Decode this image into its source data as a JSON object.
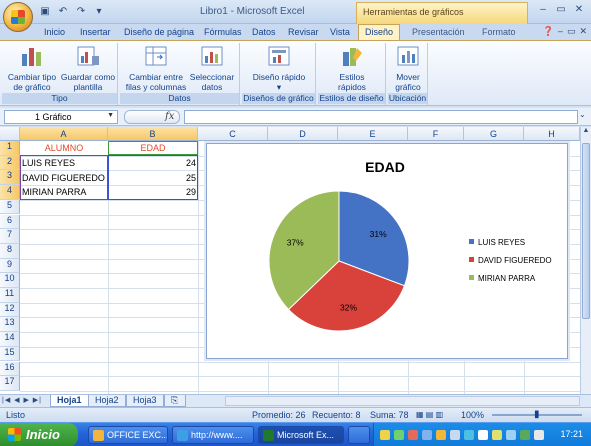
{
  "window": {
    "title": "Libro1 - Microsoft Excel",
    "contextual_header": "Herramientas de gráficos"
  },
  "tabs": [
    {
      "label": "Inicio"
    },
    {
      "label": "Insertar"
    },
    {
      "label": "Diseño de página"
    },
    {
      "label": "Fórmulas"
    },
    {
      "label": "Datos"
    },
    {
      "label": "Revisar"
    },
    {
      "label": "Vista"
    },
    {
      "label": "Diseño"
    },
    {
      "label": "Presentación"
    },
    {
      "label": "Formato"
    }
  ],
  "ribbon": {
    "groups": [
      {
        "label": "Tipo",
        "buttons": [
          {
            "label": "Cambiar tipo de gráfico"
          },
          {
            "label": "Guardar como plantilla"
          }
        ]
      },
      {
        "label": "Datos",
        "buttons": [
          {
            "label": "Cambiar entre filas y columnas"
          },
          {
            "label": "Seleccionar datos"
          }
        ]
      },
      {
        "label": "Diseños de gráfico",
        "buttons": [
          {
            "label": "Diseño rápido"
          }
        ]
      },
      {
        "label": "Estilos de diseño",
        "buttons": [
          {
            "label": "Estilos rápidos"
          }
        ]
      },
      {
        "label": "Ubicación",
        "buttons": [
          {
            "label": "Mover gráfico"
          }
        ]
      }
    ]
  },
  "formula_bar": {
    "name_box": "1 Gráfico",
    "fx": "fx"
  },
  "columns": [
    "A",
    "B",
    "C",
    "D",
    "E",
    "F",
    "G",
    "H"
  ],
  "rows": [
    "1",
    "2",
    "3",
    "4",
    "5",
    "6",
    "7",
    "8",
    "9",
    "10",
    "11",
    "12",
    "13",
    "14",
    "15",
    "16",
    "17"
  ],
  "sheet": {
    "header": {
      "a": "ALUMNO",
      "b": "EDAD"
    },
    "data": [
      {
        "name": "LUIS REYES",
        "age": "24"
      },
      {
        "name": "DAVID FIGUEREDO",
        "age": "25"
      },
      {
        "name": "MIRIAN PARRA",
        "age": "29"
      }
    ]
  },
  "chart_data": {
    "type": "pie",
    "title": "EDAD",
    "categories": [
      "LUIS REYES",
      "DAVID FIGUEREDO",
      "MIRIAN PARRA"
    ],
    "values": [
      24,
      25,
      29
    ],
    "percent_labels": [
      "31%",
      "32%",
      "37%"
    ],
    "colors": [
      "#4472c4",
      "#d9413b",
      "#9bbb59"
    ],
    "legend_position": "right"
  },
  "sheet_tabs": [
    {
      "label": "Hoja1"
    },
    {
      "label": "Hoja2"
    },
    {
      "label": "Hoja3"
    }
  ],
  "status": {
    "ready": "Listo",
    "average": "Promedio: 26",
    "count": "Recuento: 8",
    "sum": "Suma: 78",
    "zoom": "100%"
  },
  "taskbar": {
    "start": "Inicio",
    "tasks": [
      {
        "label": "OFFICE EXC..."
      },
      {
        "label": "http://www...."
      },
      {
        "label": "Microsoft Ex..."
      }
    ],
    "clock": "17:21"
  }
}
